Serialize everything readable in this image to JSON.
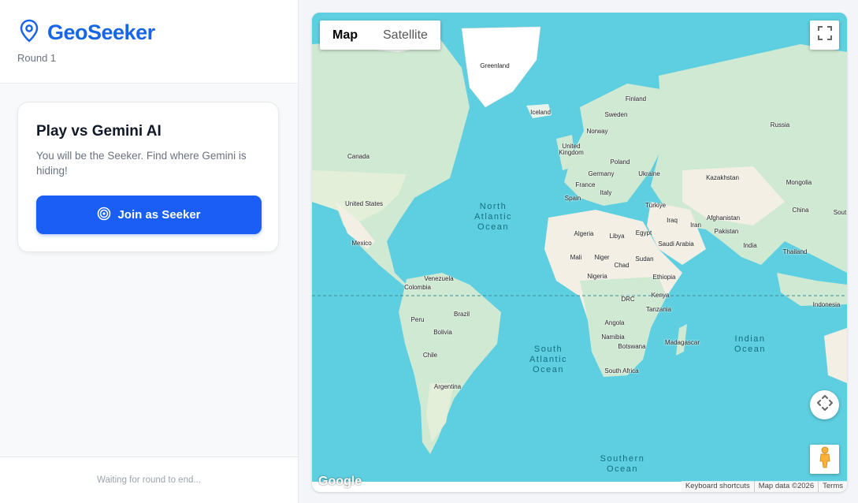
{
  "app": {
    "name": "GeoSeeker",
    "round": "Round 1"
  },
  "card": {
    "title": "Play vs Gemini AI",
    "description": "You will be the Seeker. Find where Gemini is hiding!",
    "join_label": "Join as Seeker"
  },
  "footer": {
    "status": "Waiting for round to end..."
  },
  "map": {
    "type_options": [
      "Map",
      "Satellite"
    ],
    "selected_type": "Map",
    "google_logo": "Google",
    "attribution": [
      "Keyboard shortcuts",
      "Map data ©2026",
      "Terms"
    ],
    "countries": {
      "greenland": "Greenland",
      "iceland": "Iceland",
      "finland": "Finland",
      "sweden": "Sweden",
      "norway": "Norway",
      "uk": "United\nKingdom",
      "poland": "Poland",
      "germany": "Germany",
      "ukraine": "Ukraine",
      "france": "France",
      "italy": "Italy",
      "spain": "Spain",
      "turkey": "Türkiye",
      "russia": "Russia",
      "kazakhstan": "Kazakhstan",
      "mongolia": "Mongolia",
      "china": "China",
      "afghanistan": "Afghanistan",
      "pakistan": "Pakistan",
      "iran": "Iran",
      "iraq": "Iraq",
      "saudi": "Saudi Arabia",
      "india": "India",
      "thailand": "Thailand",
      "indonesia": "Indonesia",
      "canada": "Canada",
      "usa": "United States",
      "mexico": "Mexico",
      "venezuela": "Venezuela",
      "colombia": "Colombia",
      "peru": "Peru",
      "brazil": "Brazil",
      "bolivia": "Bolivia",
      "chile": "Chile",
      "argentina": "Argentina",
      "algeria": "Algeria",
      "libya": "Libya",
      "egypt": "Egypt",
      "mali": "Mali",
      "niger": "Niger",
      "chad": "Chad",
      "sudan": "Sudan",
      "nigeria": "Nigeria",
      "ethiopia": "Ethiopia",
      "drc": "DRC",
      "kenya": "Kenya",
      "tanzania": "Tanzania",
      "angola": "Angola",
      "namibia": "Namibia",
      "botswana": "Botswana",
      "madagascar": "Madagascar",
      "south_africa": "South Africa",
      "south_cut": "Sout"
    },
    "oceans": {
      "north_atlantic": "North\nAtlantic\nOcean",
      "south_atlantic": "South\nAtlantic\nOcean",
      "indian": "Indian\nOcean",
      "southern": "Southern\nOcean"
    }
  },
  "colors": {
    "brand": "#1766e8",
    "button": "#1b5ef5",
    "ocean": "#5ecfe0",
    "land": "#cfe9d3",
    "land_desert": "#f3efe4"
  }
}
